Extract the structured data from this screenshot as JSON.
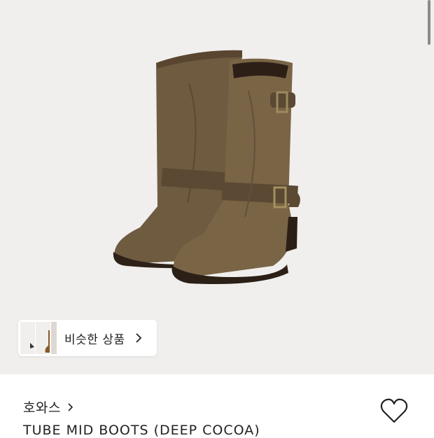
{
  "product": {
    "image_alt": "brown suede mid boots with buckle straps",
    "similar_label": "비슷한 상품",
    "brand": "호와스",
    "title": "TUBE MID BOOTS (DEEP COCOA)"
  },
  "icons": {
    "similar_chevron": "chevron-right-icon",
    "brand_chevron": "chevron-right-icon",
    "wishlist": "heart-outline-icon"
  },
  "colors": {
    "hero_bg": "#f0efed",
    "suede": "#6e5a3f",
    "text": "#222222"
  }
}
